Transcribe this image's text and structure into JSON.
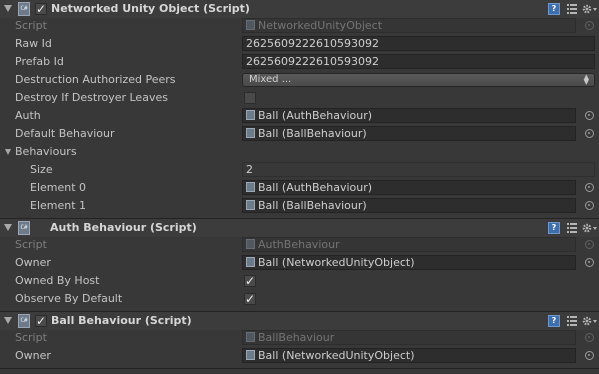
{
  "components": [
    {
      "title": "Networked Unity Object (Script)",
      "enabled": true,
      "rows": {
        "script_label": "Script",
        "script_value": "NetworkedUnityObject",
        "raw_id_label": "Raw Id",
        "raw_id_value": "2625609222610593092",
        "prefab_id_label": "Prefab Id",
        "prefab_id_value": "2625609222610593092",
        "dap_label": "Destruction Authorized Peers",
        "dap_value": "Mixed ...",
        "ddl_label": "Destroy If Destroyer Leaves",
        "ddl_checked": false,
        "auth_label": "Auth",
        "auth_value": "Ball (AuthBehaviour)",
        "default_label": "Default Behaviour",
        "default_value": "Ball (BallBehaviour)",
        "behaviours_label": "Behaviours",
        "size_label": "Size",
        "size_value": "2",
        "el0_label": "Element 0",
        "el0_value": "Ball (AuthBehaviour)",
        "el1_label": "Element 1",
        "el1_value": "Ball (BallBehaviour)"
      }
    },
    {
      "title": "Auth Behaviour (Script)",
      "rows": {
        "script_label": "Script",
        "script_value": "AuthBehaviour",
        "owner_label": "Owner",
        "owner_value": "Ball (NetworkedUnityObject)",
        "host_label": "Owned By Host",
        "host_checked": true,
        "observe_label": "Observe By Default",
        "observe_checked": true
      }
    },
    {
      "title": "Ball Behaviour (Script)",
      "enabled": true,
      "rows": {
        "script_label": "Script",
        "script_value": "BallBehaviour",
        "owner_label": "Owner",
        "owner_value": "Ball (NetworkedUnityObject)"
      }
    }
  ],
  "glyphs": {
    "check": "✓",
    "help": "?",
    "script_icon": "C#",
    "dropdown_arrows": "▲▼"
  },
  "colors": {
    "background": "#383838",
    "header": "#3c3c3c",
    "field": "#2d2d2d",
    "help_blue": "#3d6fb0"
  }
}
